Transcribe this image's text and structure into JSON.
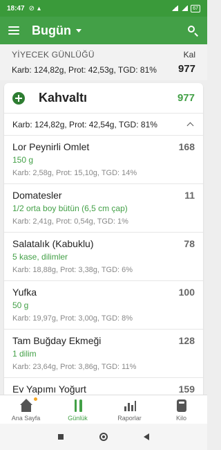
{
  "status_bar": {
    "time": "18:47",
    "icons": [
      "muted-notification-icon",
      "alarm-icon",
      "signal-icon",
      "wifi-icon",
      "battery-icon"
    ],
    "battery": "67"
  },
  "app_bar": {
    "title": "Bugün",
    "icons": [
      "menu-icon",
      "dropdown-caret-icon",
      "search-icon"
    ]
  },
  "diary": {
    "label": "YİYECEK GÜNLÜĞÜ",
    "cal_header": "Kal",
    "summary": "Karb: 124,82g, Prot: 42,53g, TGD: 81%",
    "total_cal": "977"
  },
  "meal": {
    "name": "Kahvaltı",
    "calories": "977",
    "summary": "Karb: 124,82g, Prot: 42,54g, TGD: 81%"
  },
  "foods": [
    {
      "name": "Lor Peynirli Omlet",
      "calories": "168",
      "serving": "150  g",
      "macros": "Karb: 2,58g, Prot: 15,10g, TGD: 14%"
    },
    {
      "name": "Domatesler",
      "calories": "11",
      "serving": "1/2 orta boy bütün (6,5 cm çap)",
      "macros": "Karb: 2,41g, Prot: 0,54g, TGD: 1%"
    },
    {
      "name": "Salatalık (Kabuklu)",
      "calories": "78",
      "serving": "5  kase, dilimler",
      "macros": "Karb: 18,88g, Prot: 3,38g, TGD: 6%"
    },
    {
      "name": "Yufka",
      "calories": "100",
      "serving": "50  g",
      "macros": "Karb: 19,97g, Prot: 3,00g, TGD: 8%"
    },
    {
      "name": "Tam Buğday Ekmeği",
      "calories": "128",
      "serving": "1  dilim",
      "macros": "Karb: 23,64g, Prot: 3,86g, TGD: 11%"
    },
    {
      "name": "Ev Yapımı Yoğurt",
      "calories": "159",
      "serving": "",
      "macros": ""
    }
  ],
  "bottom_nav": {
    "items": [
      {
        "label": "Ana Sayfa",
        "icon": "home-icon"
      },
      {
        "label": "Günlük",
        "icon": "fork-knife-icon",
        "active": true
      },
      {
        "label": "Raporlar",
        "icon": "reports-icon"
      },
      {
        "label": "Kilo",
        "icon": "scale-icon"
      }
    ]
  },
  "colors": {
    "status_bar": "#3a9a3a",
    "app_bar": "#43a047",
    "accent": "#43a047",
    "notification_dot": "#f5a623"
  }
}
